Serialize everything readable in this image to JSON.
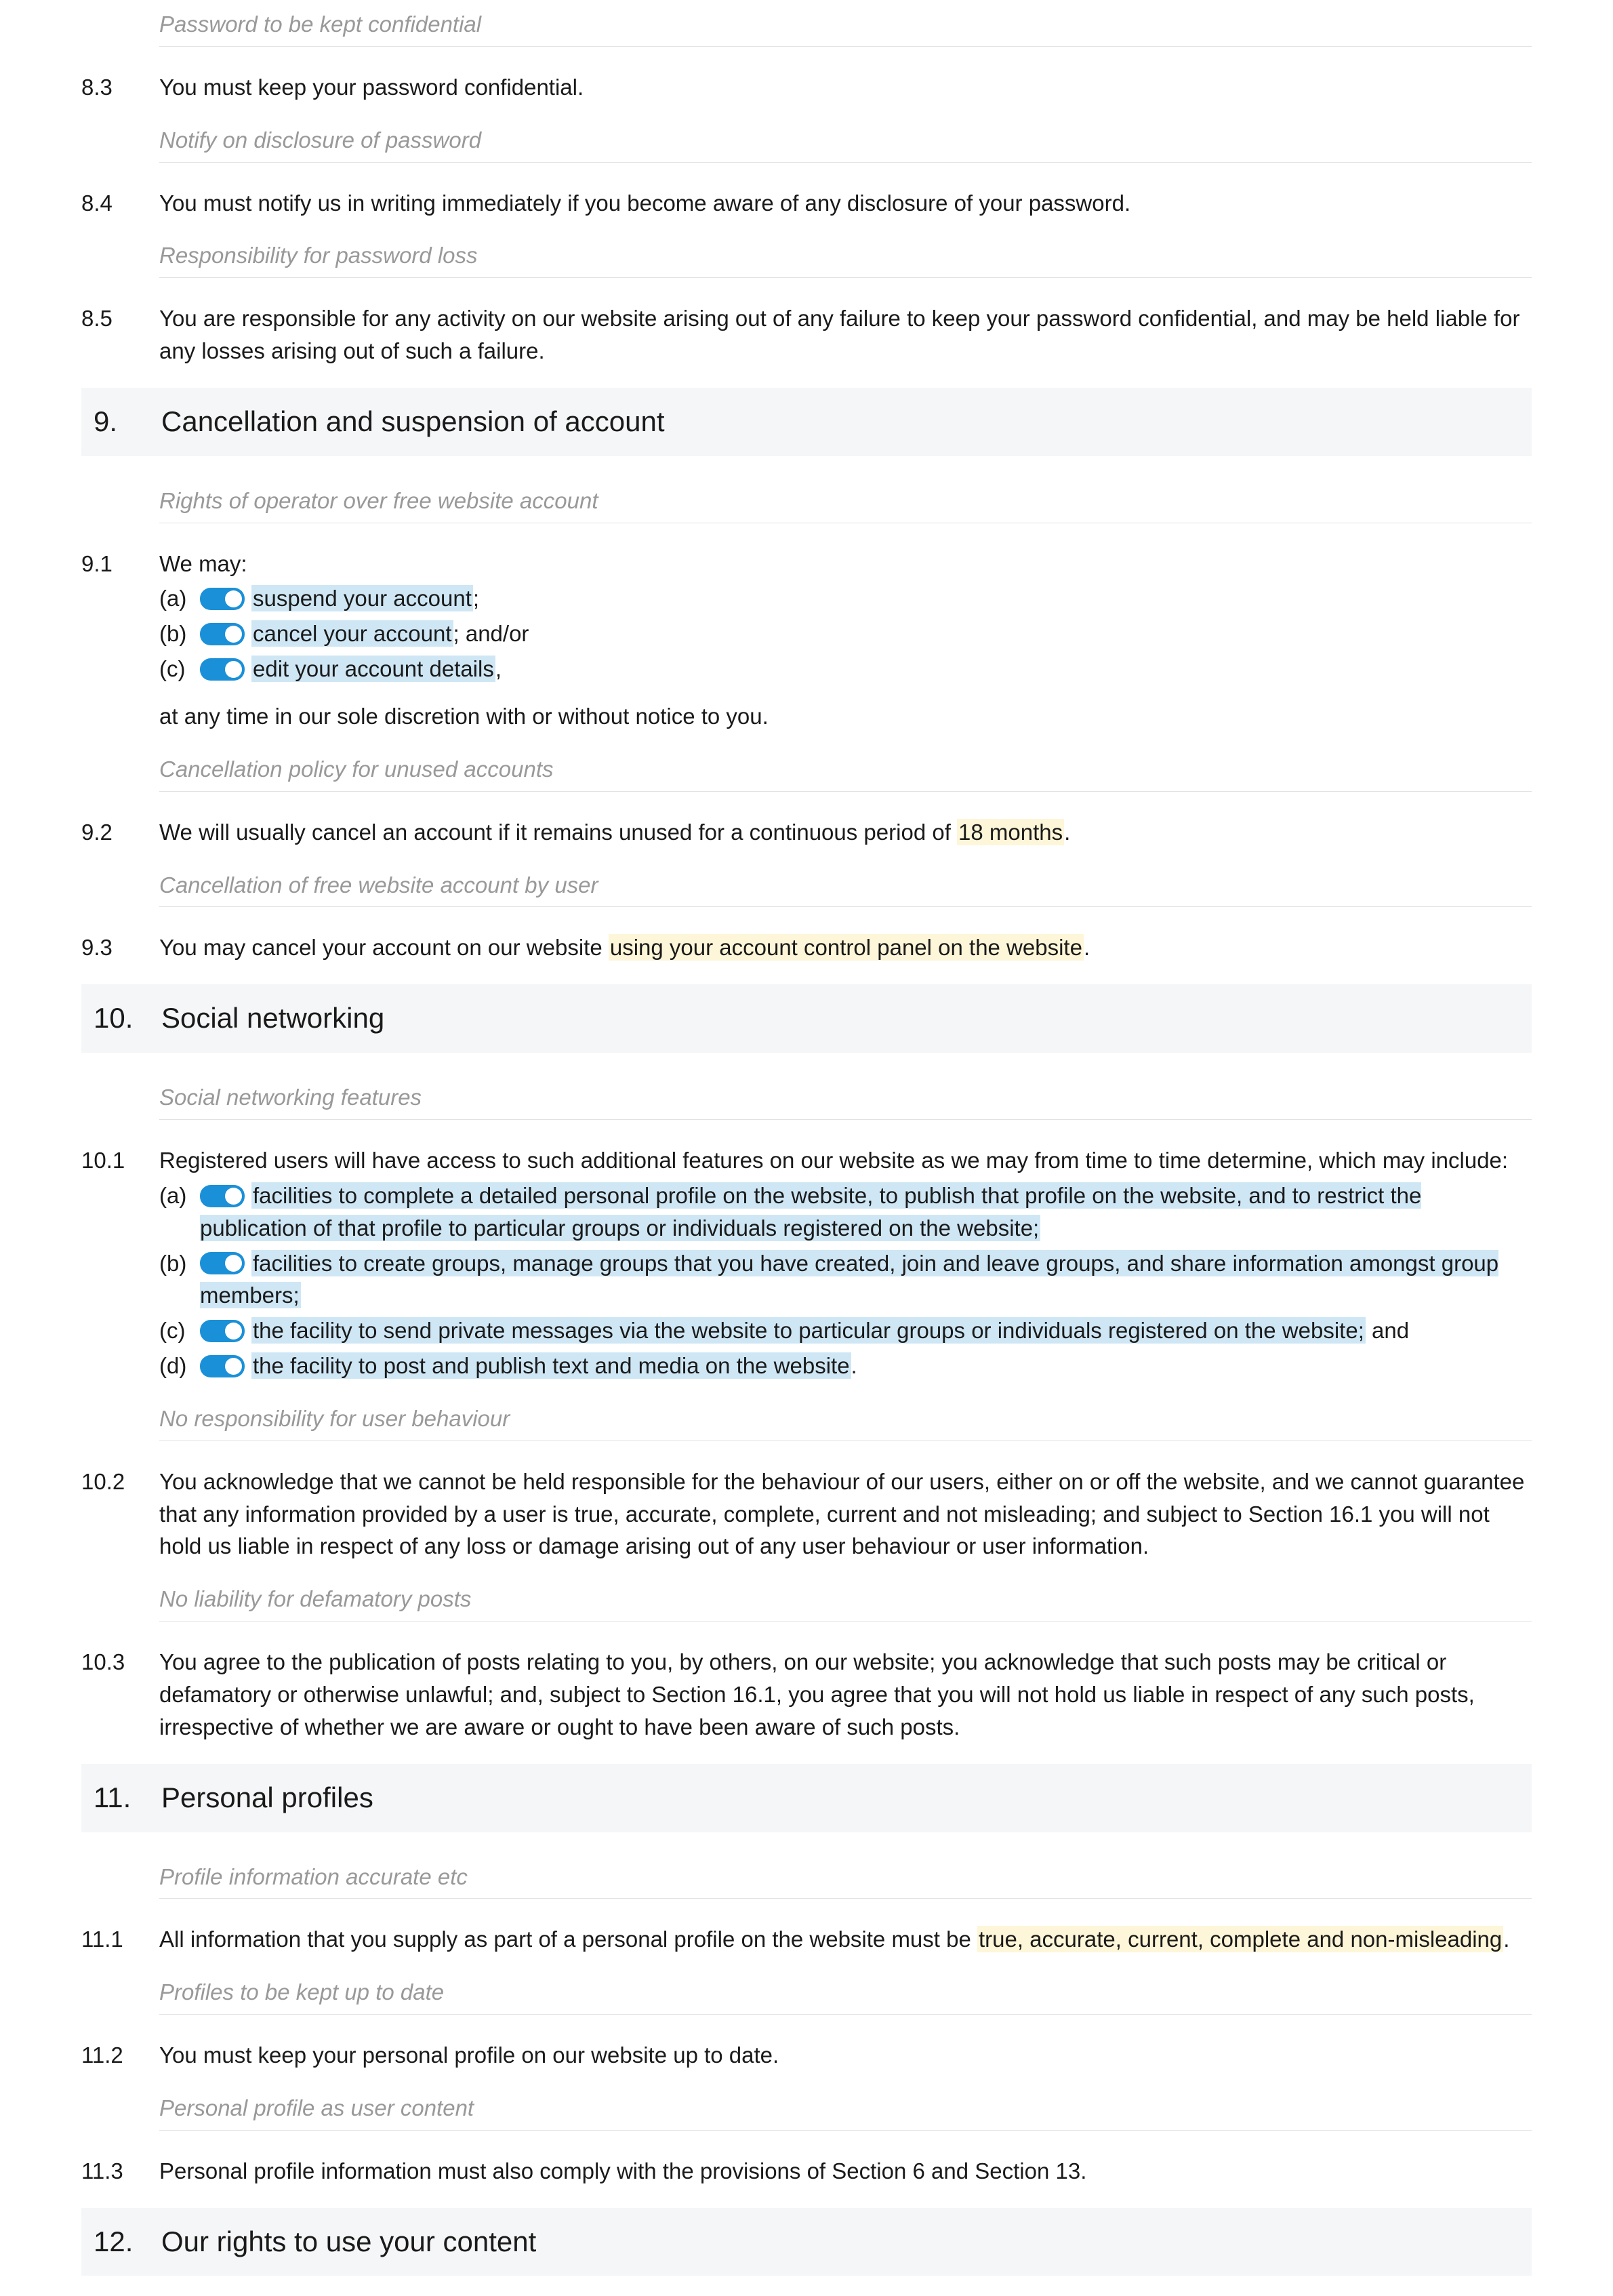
{
  "c83": {
    "heading": "Password to be kept confidential",
    "num": "8.3",
    "text": "You must keep your password confidential."
  },
  "c84": {
    "heading": "Notify on disclosure of password",
    "num": "8.4",
    "text": "You must notify us in writing immediately if you become aware of any disclosure of your password."
  },
  "c85": {
    "heading": "Responsibility for password loss",
    "num": "8.5",
    "text": "You are responsible for any activity on our website arising out of any failure to keep your password confidential, and may be held liable for any losses arising out of such a failure."
  },
  "s9": {
    "num": "9.",
    "title": "Cancellation and suspension of account"
  },
  "c91": {
    "heading": "Rights of operator over free website account",
    "num": "9.1",
    "intro": "We may:",
    "a_label": "(a)",
    "a_hl": "suspend your account",
    "a_tail": ";",
    "b_label": "(b)",
    "b_hl": "cancel your account",
    "b_tail": "; and/or",
    "c_label": "(c)",
    "c_hl": "edit your account details",
    "c_tail": ",",
    "outro": "at any time in our sole discretion with or without notice to you."
  },
  "c92": {
    "heading": "Cancellation policy for unused accounts",
    "num": "9.2",
    "pre": "We will usually cancel an account if it remains unused for a continuous period of ",
    "hl": "18 months",
    "post": "."
  },
  "c93": {
    "heading": "Cancellation of free website account by user",
    "num": "9.3",
    "pre": "You may cancel your account on our website ",
    "hl": "using your account control panel on the website",
    "post": "."
  },
  "s10": {
    "num": "10.",
    "title": "Social networking"
  },
  "c101": {
    "heading": "Social networking features",
    "num": "10.1",
    "intro": "Registered users will have access to such additional features on our website as we may from time to time determine, which may include:",
    "a_label": "(a)",
    "a_hl": "facilities to complete a detailed personal profile on the website, to publish that profile on the website, and to restrict the publication of that profile to particular groups or individuals registered on the website;",
    "b_label": "(b)",
    "b_hl": "facilities to create groups, manage groups that you have created, join and leave groups, and share information amongst group members;",
    "c_label": "(c)",
    "c_hl": "the facility to send private messages via the website to particular groups or individuals registered on the website;",
    "c_tail": " and",
    "d_label": "(d)",
    "d_hl": "the facility to post and publish text and media on the website",
    "d_tail": "."
  },
  "c102": {
    "heading": "No responsibility for user behaviour",
    "num": "10.2",
    "text": "You acknowledge that we cannot be held responsible for the behaviour of our users, either on or off the website, and we cannot guarantee that any information provided by a user is true, accurate, complete, current and not misleading; and subject to Section 16.1 you will not hold us liable in respect of any loss or damage arising out of any user behaviour or user information."
  },
  "c103": {
    "heading": "No liability for defamatory posts",
    "num": "10.3",
    "text": "You agree to the publication of posts relating to you, by others, on our website; you acknowledge that such posts may be critical or defamatory or otherwise unlawful; and, subject to Section 16.1, you agree that you will not hold us liable in respect of any such posts, irrespective of whether we are aware or ought to have been aware of such posts."
  },
  "s11": {
    "num": "11.",
    "title": "Personal profiles"
  },
  "c111": {
    "heading": "Profile information accurate etc",
    "num": "11.1",
    "pre": "All information that you supply as part of a personal profile on the website must be ",
    "hl": "true, accurate, current, complete and non-misleading",
    "post": "."
  },
  "c112": {
    "heading": "Profiles to be kept up to date",
    "num": "11.2",
    "text": "You must keep your personal profile on our website up to date."
  },
  "c113": {
    "heading": "Personal profile as user content",
    "num": "11.3",
    "text": "Personal profile information must also comply with the provisions of Section 6 and Section 13."
  },
  "s12": {
    "num": "12.",
    "title": "Our rights to use your content"
  }
}
